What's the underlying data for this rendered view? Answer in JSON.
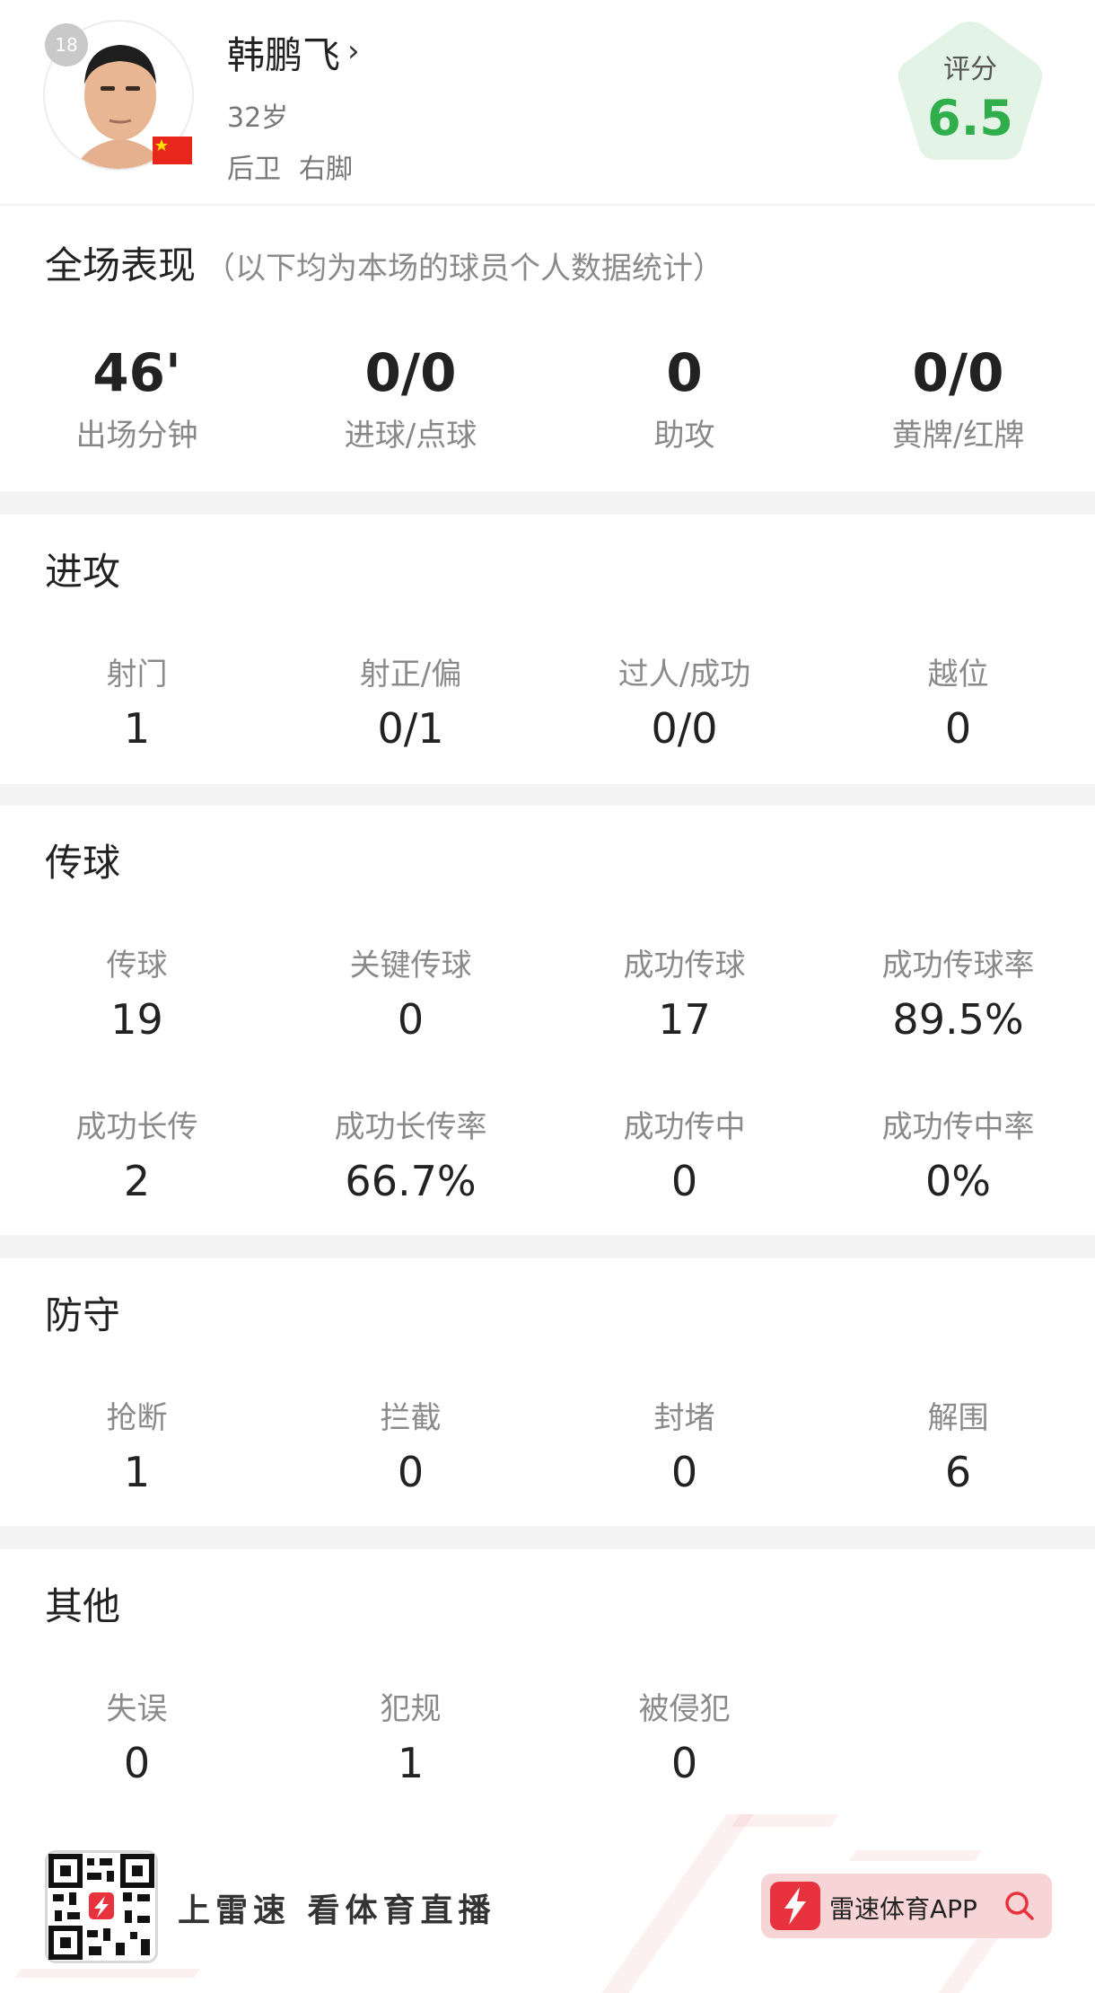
{
  "player": {
    "number": "18",
    "name": "韩鹏飞",
    "age": "32岁",
    "position": "后卫",
    "foot": "右脚",
    "rating_label": "评分",
    "rating_value": "6.5"
  },
  "overview": {
    "title": "全场表现",
    "subtitle": "（以下均为本场的球员个人数据统计）",
    "stats": [
      {
        "value": "46'",
        "label": "出场分钟"
      },
      {
        "value": "0/0",
        "label": "进球/点球"
      },
      {
        "value": "0",
        "label": "助攻"
      },
      {
        "value": "0/0",
        "label": "黄牌/红牌"
      }
    ]
  },
  "attack": {
    "title": "进攻",
    "stats": [
      {
        "label": "射门",
        "value": "1"
      },
      {
        "label": "射正/偏",
        "value": "0/1"
      },
      {
        "label": "过人/成功",
        "value": "0/0"
      },
      {
        "label": "越位",
        "value": "0"
      }
    ]
  },
  "passing": {
    "title": "传球",
    "stats": [
      {
        "label": "传球",
        "value": "19"
      },
      {
        "label": "关键传球",
        "value": "0"
      },
      {
        "label": "成功传球",
        "value": "17"
      },
      {
        "label": "成功传球率",
        "value": "89.5%"
      },
      {
        "label": "成功长传",
        "value": "2"
      },
      {
        "label": "成功长传率",
        "value": "66.7%"
      },
      {
        "label": "成功传中",
        "value": "0"
      },
      {
        "label": "成功传中率",
        "value": "0%"
      }
    ]
  },
  "defense": {
    "title": "防守",
    "stats": [
      {
        "label": "抢断",
        "value": "1"
      },
      {
        "label": "拦截",
        "value": "0"
      },
      {
        "label": "封堵",
        "value": "0"
      },
      {
        "label": "解围",
        "value": "6"
      }
    ]
  },
  "other": {
    "title": "其他",
    "stats": [
      {
        "label": "失误",
        "value": "0"
      },
      {
        "label": "犯规",
        "value": "1"
      },
      {
        "label": "被侵犯",
        "value": "0"
      }
    ]
  },
  "footer": {
    "slogan": "上雷速 看体育直播",
    "app_name": "雷速体育APP"
  },
  "colors": {
    "rating_green": "#2fae4b",
    "rating_bg": "#e3f3e6",
    "brand_red": "#e8333e"
  },
  "icons": [
    "player-avatar-photo",
    "china-flag-icon",
    "chevron-right-icon",
    "qr-code",
    "lightning-logo-icon",
    "search-icon"
  ]
}
